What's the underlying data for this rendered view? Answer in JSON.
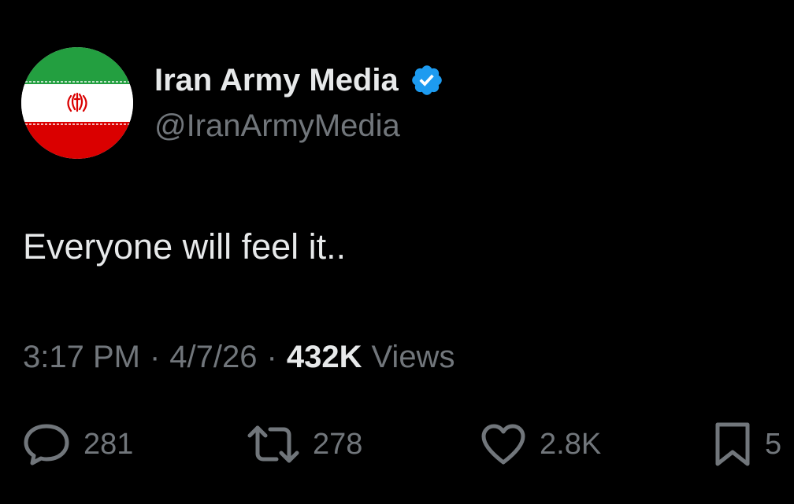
{
  "author": {
    "display_name": "Iran Army Media",
    "handle": "@IranArmyMedia",
    "verified": true,
    "avatar_icon": "iran-flag-icon"
  },
  "tweet": {
    "text": "Everyone will feel it.."
  },
  "meta": {
    "time": "3:17 PM",
    "separator": "·",
    "date": "4/7/26",
    "views_count": "432K",
    "views_label": "Views"
  },
  "actions": {
    "reply": {
      "icon": "reply-icon",
      "count": "281"
    },
    "retweet": {
      "icon": "retweet-icon",
      "count": "278"
    },
    "like": {
      "icon": "heart-icon",
      "count": "2.8K"
    },
    "bookmark": {
      "icon": "bookmark-icon",
      "count": "5"
    }
  },
  "colors": {
    "background": "#000000",
    "primary_text": "#e7e9ea",
    "secondary_text": "#71767b",
    "verified_blue": "#1d9bf0",
    "flag_green": "#239f40",
    "flag_white": "#ffffff",
    "flag_red": "#da0000"
  }
}
